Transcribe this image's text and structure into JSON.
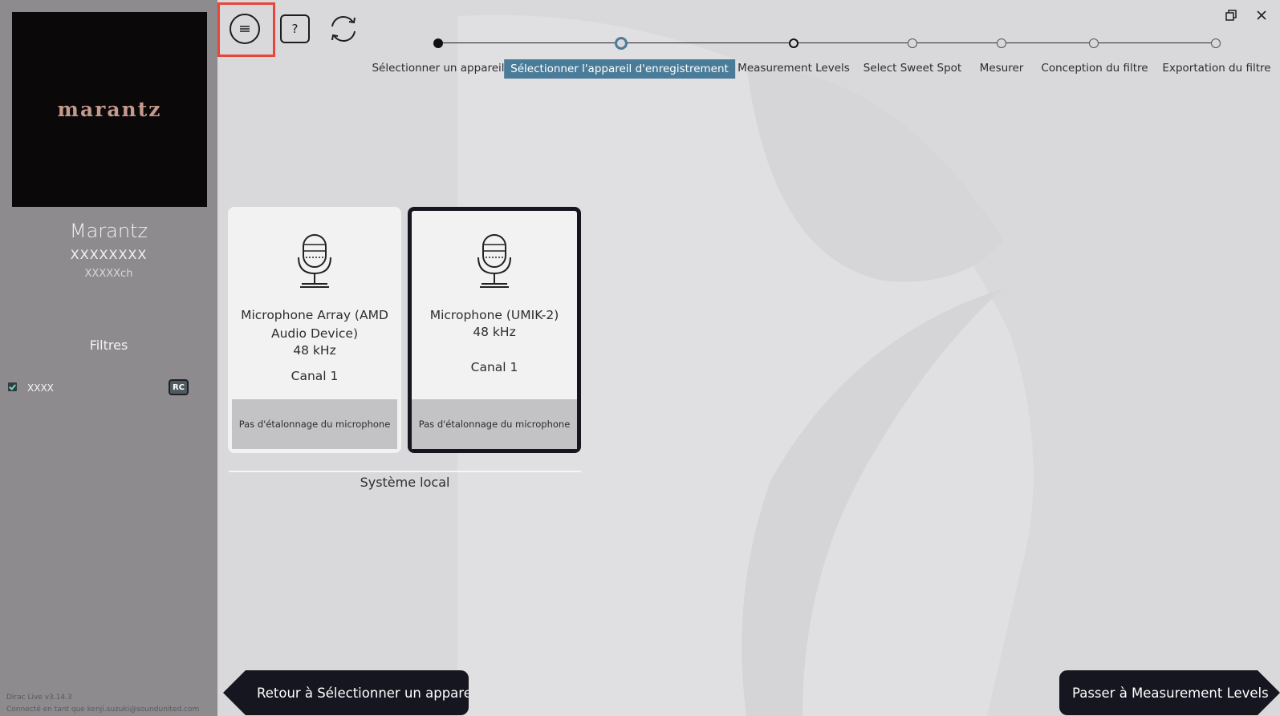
{
  "sidebar": {
    "logo_text": "marantz",
    "device_brand": "Marantz",
    "device_model": "XXXXXXXX",
    "device_channels": "XXXXXch",
    "filters_title": "Filtres",
    "filters": [
      {
        "name": "XXXX",
        "badge": "RC",
        "checked": true
      }
    ],
    "version": "Dirac Live v3.14.3",
    "connected": "Connecté en tant que kenji.suzuki@soundunited.com"
  },
  "toolbar": {
    "help_label": "?"
  },
  "stepper": {
    "active_color": "#4a7c99",
    "steps": [
      {
        "label": "Sélectionner un appareil",
        "state": "done"
      },
      {
        "label": "Sélectionner l'appareil d'enregistrement",
        "state": "active"
      },
      {
        "label": "Measurement Levels",
        "state": "next"
      },
      {
        "label": "Select Sweet Spot",
        "state": "pending"
      },
      {
        "label": "Mesurer",
        "state": "pending"
      },
      {
        "label": "Conception du filtre",
        "state": "pending"
      },
      {
        "label": "Exportation du filtre",
        "state": "pending"
      }
    ]
  },
  "devices": [
    {
      "name": "Microphone Array (AMD Audio Device)",
      "rate": "48 kHz",
      "channel": "Canal 1",
      "calibration": "Pas d'étalonnage du microphone",
      "selected": false
    },
    {
      "name": "Microphone (UMIK-2)",
      "rate": "48 kHz",
      "channel": "Canal 1",
      "calibration": "Pas d'étalonnage du microphone",
      "selected": true
    }
  ],
  "group_label": "Système local",
  "nav": {
    "back_label": "Retour à Sélectionner un appareil",
    "next_label": "Passer à Measurement Levels"
  }
}
